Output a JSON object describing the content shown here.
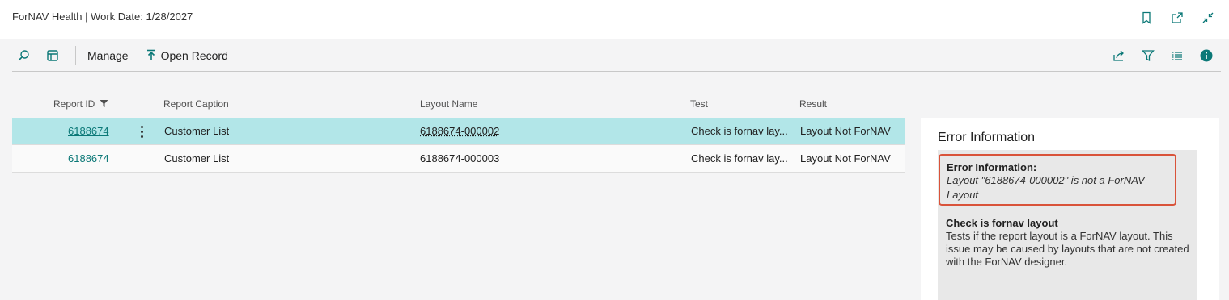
{
  "window": {
    "title": "ForNAV Health | Work Date: 1/28/2027"
  },
  "toolbar": {
    "manage_label": "Manage",
    "open_record_label": "Open Record"
  },
  "columns": {
    "report_id": "Report ID",
    "report_caption": "Report Caption",
    "layout_name": "Layout Name",
    "test": "Test",
    "result": "Result"
  },
  "rows": [
    {
      "report_id": "6188674",
      "report_caption": "Customer List",
      "layout_name": "6188674-000002",
      "test": "Check is fornav lay...",
      "result": "Layout Not ForNAV"
    },
    {
      "report_id": "6188674",
      "report_caption": "Customer List",
      "layout_name": "6188674-000003",
      "test": "Check is fornav lay...",
      "result": "Layout Not ForNAV"
    }
  ],
  "factbox": {
    "title": "Error Information",
    "error_heading": "Error Information:",
    "error_message": "Layout \"6188674-000002\" is not a ForNAV Layout",
    "check_heading": "Check is fornav layout",
    "check_description": "Tests if the report layout is a ForNAV layout. This issue may be caused by layouts that are not created with the ForNAV designer."
  },
  "icons": {
    "title_bar": [
      "bookmark-icon",
      "open-new-window-icon",
      "collapse-icon"
    ],
    "toolbar_left": [
      "search-icon",
      "show-as-cards-icon",
      "pin-icon"
    ],
    "toolbar_right": [
      "share-icon",
      "filter-icon",
      "list-view-icon",
      "info-icon"
    ]
  },
  "colors": {
    "accent": "#0b7877",
    "selected_row": "#b2e6e8",
    "highlight_border": "#d9533a"
  }
}
